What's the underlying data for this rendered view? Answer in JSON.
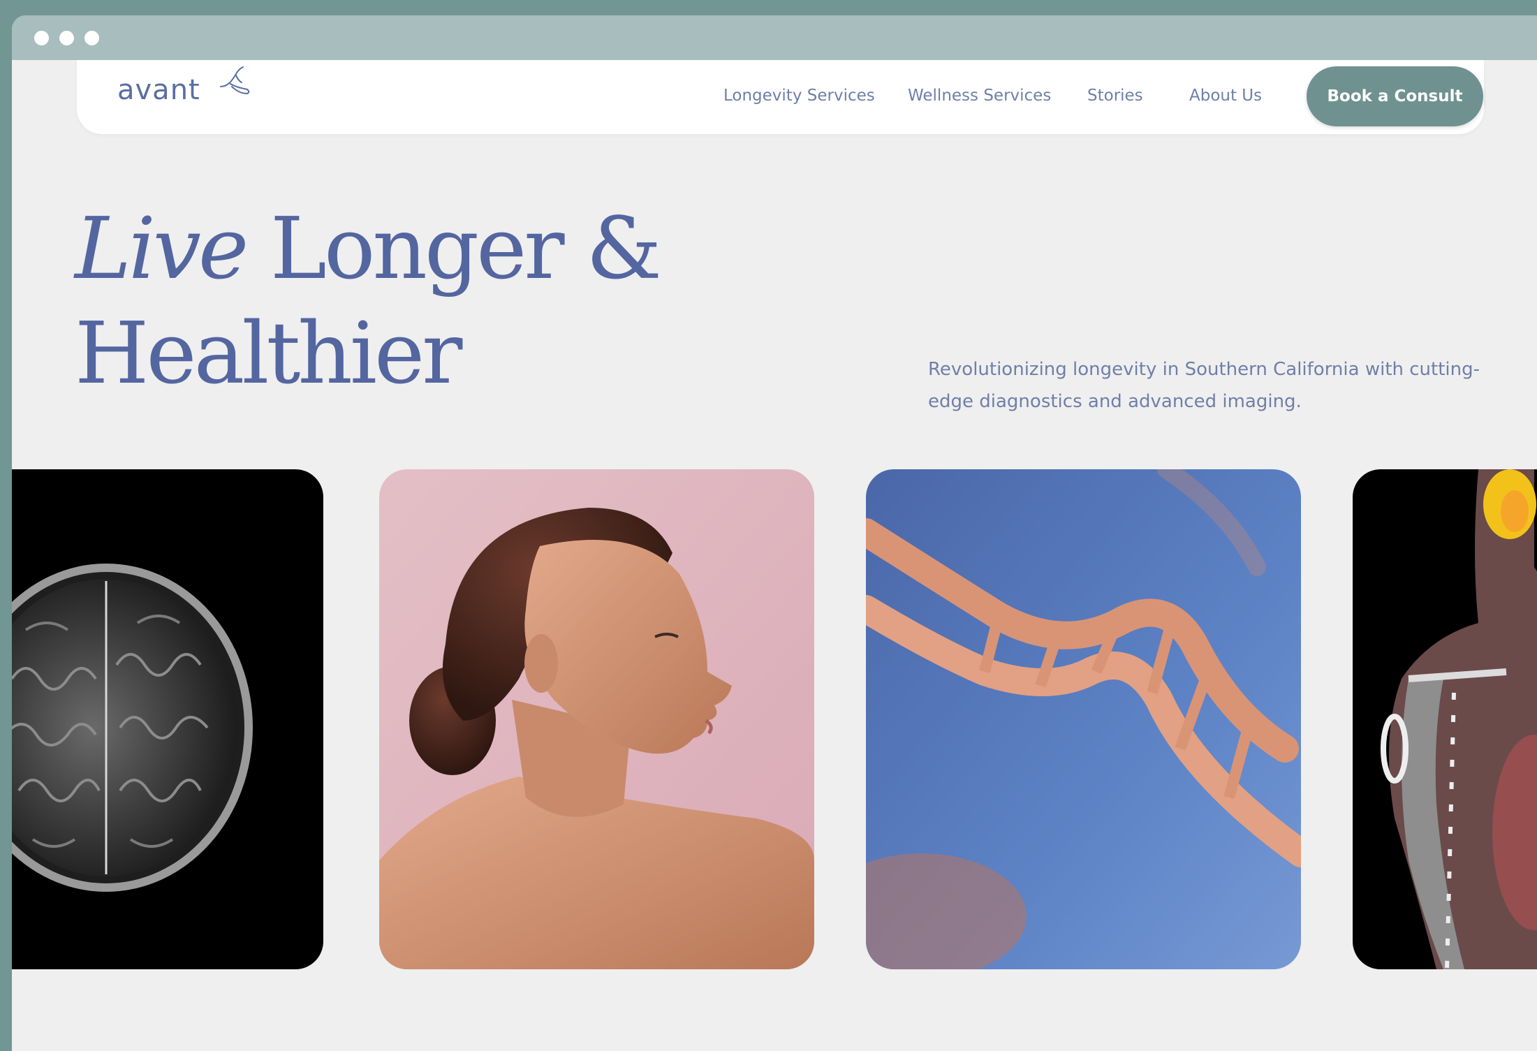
{
  "browser": {
    "dots": [
      "window-dot-1",
      "window-dot-2",
      "window-dot-3"
    ]
  },
  "nav": {
    "logo_text": "avant",
    "links": [
      {
        "label": "Longevity Services"
      },
      {
        "label": "Wellness Services"
      },
      {
        "label": "Stories"
      },
      {
        "label": "About Us"
      }
    ],
    "cta_label": "Book a Consult"
  },
  "hero": {
    "title_italic": "Live",
    "title_rest": " Longer &",
    "title_line2": "Healthier",
    "subtitle": "Revolutionizing longevity in Southern California with cutting-edge diagnostics and advanced imaging."
  },
  "gallery": {
    "images": [
      {
        "name": "brain-mri-scan"
      },
      {
        "name": "woman-profile-portrait"
      },
      {
        "name": "dna-helix"
      },
      {
        "name": "body-pet-ct-scan"
      }
    ]
  },
  "colors": {
    "frame": "#719694",
    "chrome": "#a7bdbe",
    "page_bg": "#efefef",
    "brand_blue": "#5466a0",
    "accent_green": "#6f9290"
  }
}
